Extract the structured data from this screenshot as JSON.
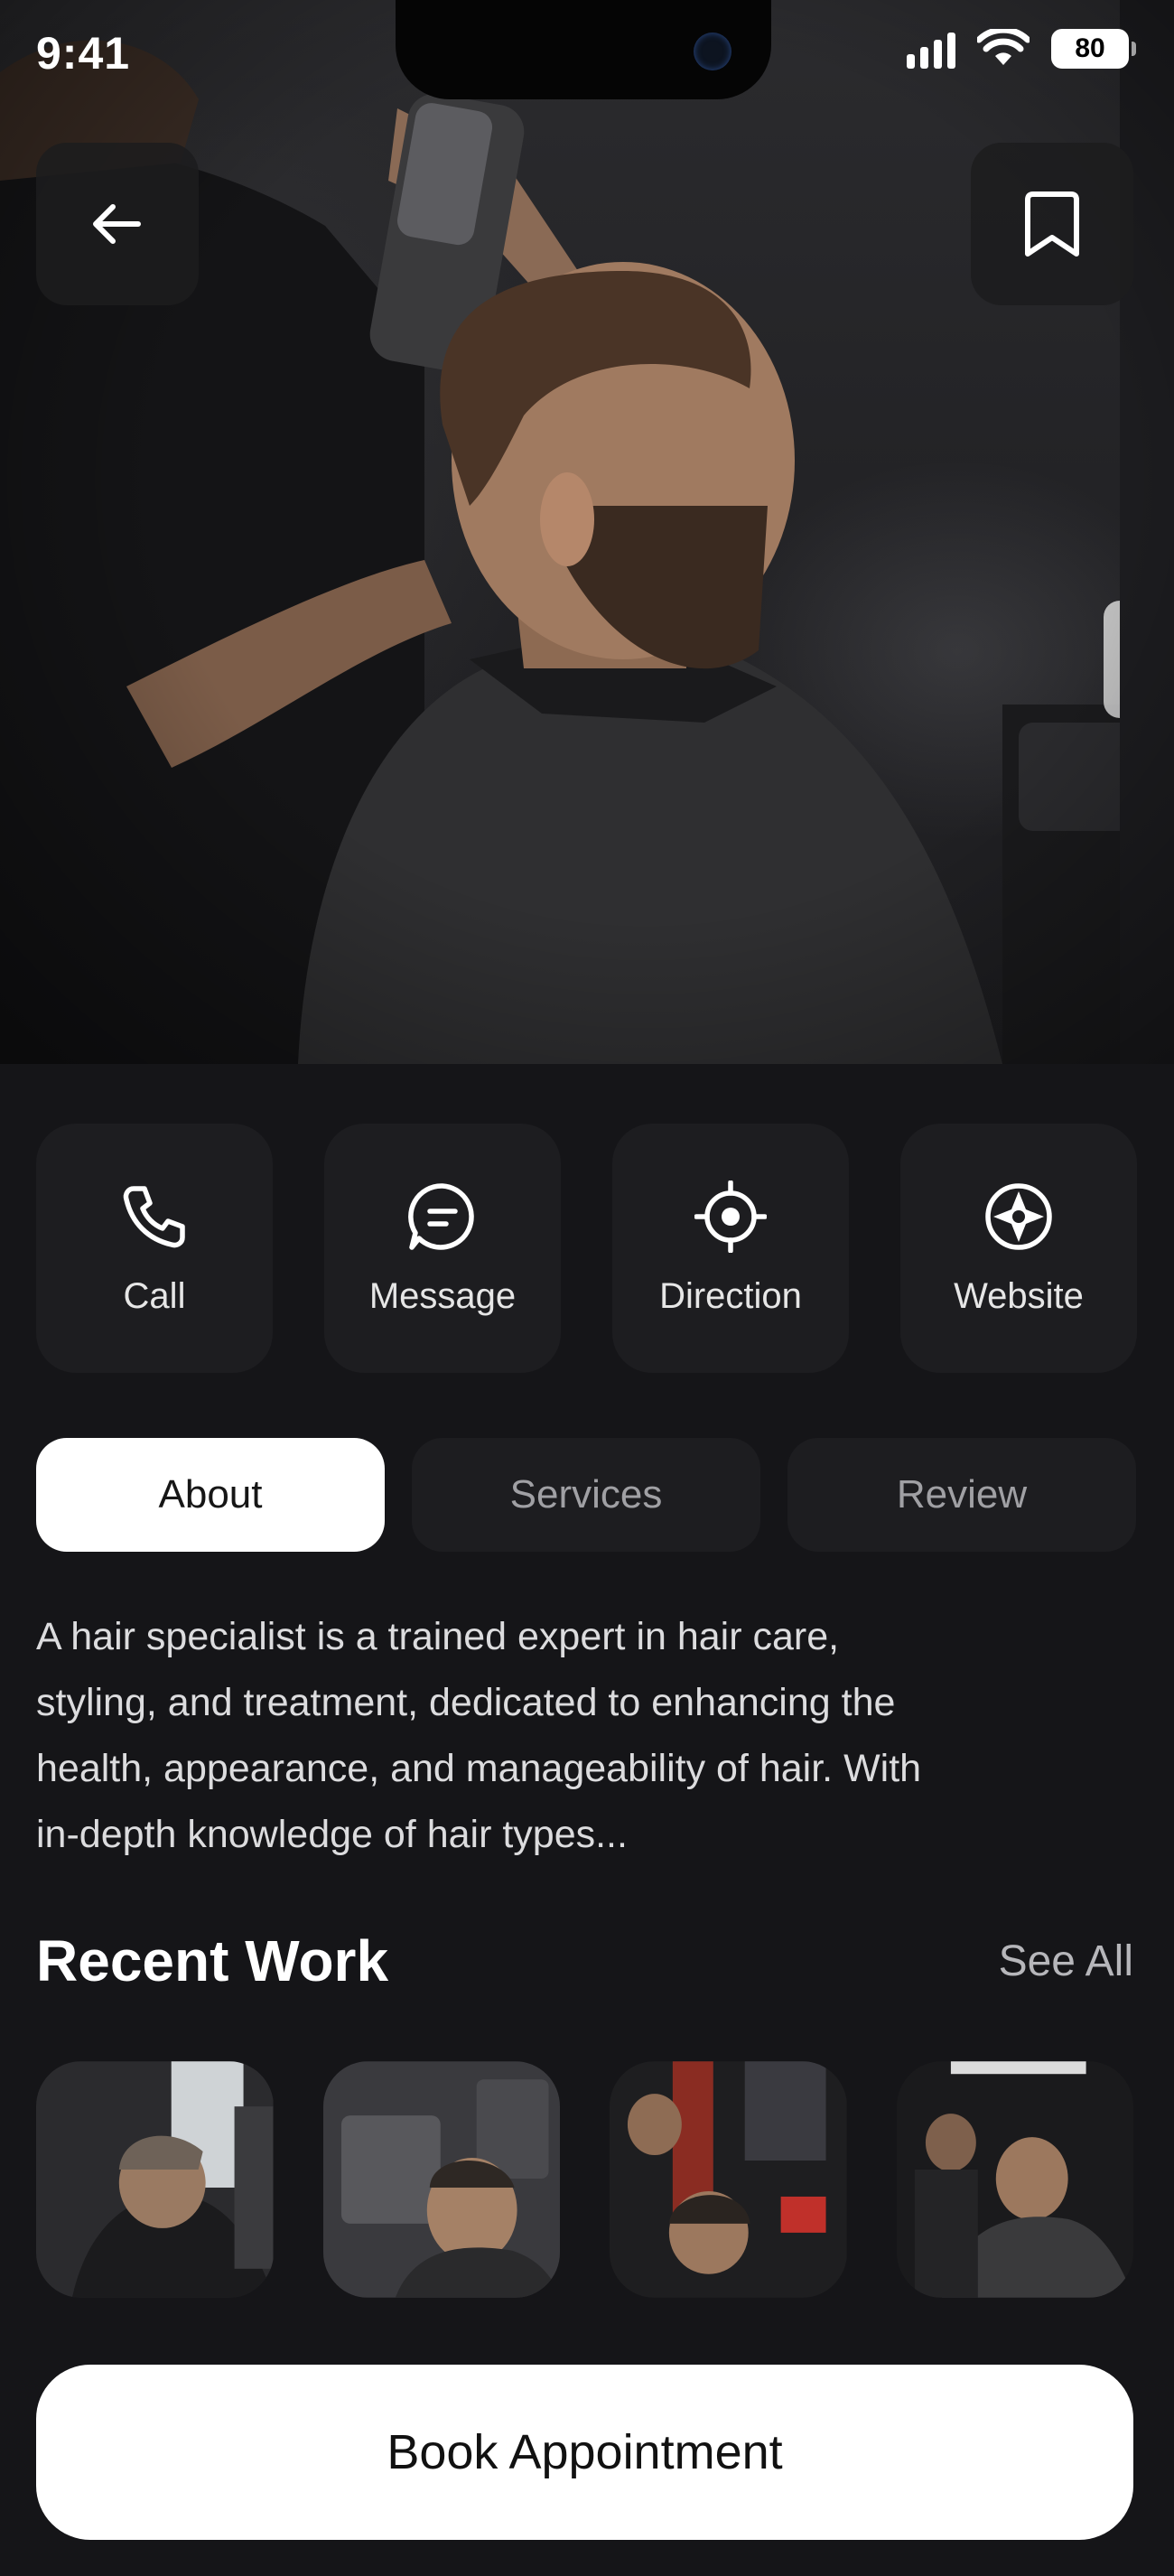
{
  "status_bar": {
    "time": "9:41",
    "battery": "80"
  },
  "hero": {
    "image_alt": "Barber cutting a man's hair",
    "back_icon": "arrow-left-icon",
    "bookmark_icon": "bookmark-icon"
  },
  "actions": [
    {
      "label": "Call",
      "icon": "phone-icon"
    },
    {
      "label": "Message",
      "icon": "message-icon"
    },
    {
      "label": "Direction",
      "icon": "target-icon"
    },
    {
      "label": "Website",
      "icon": "compass-icon"
    }
  ],
  "tabs": [
    {
      "label": "About",
      "active": true
    },
    {
      "label": "Services",
      "active": false
    },
    {
      "label": "Review",
      "active": false
    }
  ],
  "about": {
    "lines": [
      "A hair specialist is a trained expert in hair care,",
      "styling, and treatment, dedicated to enhancing the",
      "health, appearance, and manageability of hair. With",
      "in-depth knowledge of hair types..."
    ]
  },
  "recent_work": {
    "title": "Recent Work",
    "see_all": "See All",
    "items": [
      "recent-work-1",
      "recent-work-2",
      "recent-work-3",
      "recent-work-4"
    ]
  },
  "cta": {
    "label": "Book Appointment"
  },
  "colors": {
    "background": "#151518",
    "tile": "#1d1d20",
    "accent": "#ffffff"
  }
}
